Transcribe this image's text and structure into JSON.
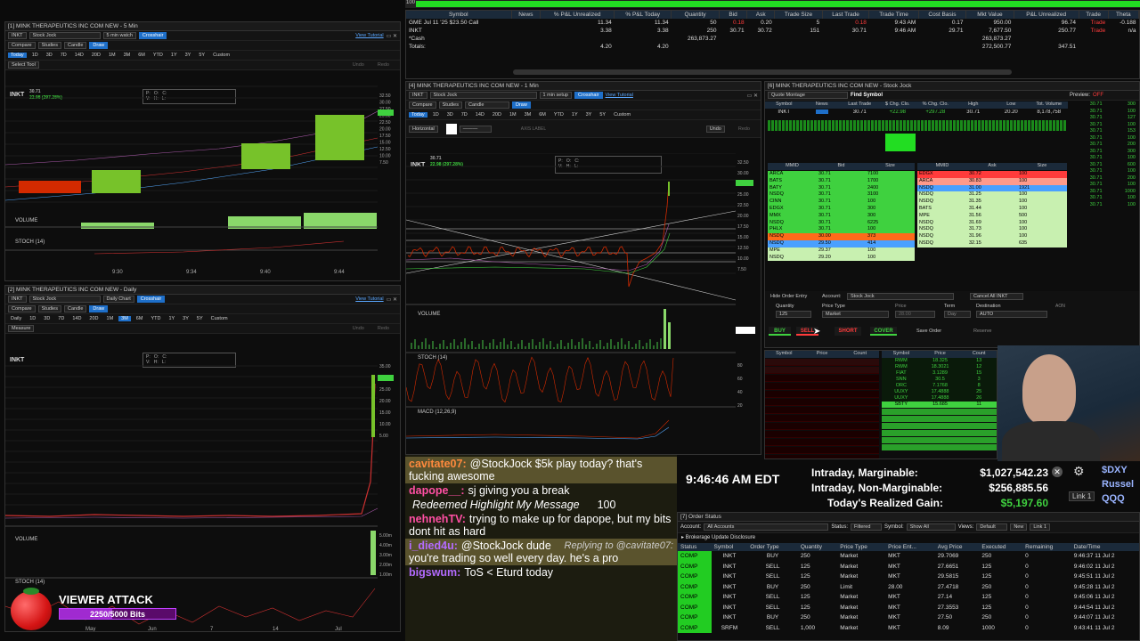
{
  "topbar": {
    "value": "100"
  },
  "watchlist": {
    "columns": [
      "Symbol",
      "News",
      "% P&L Unrealized",
      "% P&L Today",
      "Quantity",
      "Bid",
      "Ask",
      "Trade Size",
      "Last Trade",
      "Trade Time",
      "Cost Basis",
      "Mkt Value",
      "P&L Unrealized",
      "Trade",
      "Theta"
    ],
    "rows": [
      [
        "GME Jul 11 '25 $23.50 Call",
        "",
        "11.34",
        "11.34",
        "50",
        "0.18",
        "0.20",
        "5",
        "0.18",
        "9:43 AM",
        "0.17",
        "950.00",
        "96.74",
        "Trade",
        "-0.188"
      ],
      [
        "INKT",
        "",
        "3.38",
        "3.38",
        "250",
        "30.71",
        "30.72",
        "151",
        "30.71",
        "9:46 AM",
        "29.71",
        "7,677.50",
        "250.77",
        "Trade",
        "n/a"
      ],
      [
        "*Cash",
        "",
        "",
        "",
        "263,873.27",
        "",
        "",
        "",
        "",
        "",
        "",
        "263,873.27",
        "",
        "",
        ""
      ],
      [
        "Totals:",
        "",
        "4.20",
        "4.20",
        "",
        "",
        "",
        "",
        "",
        "",
        "",
        "272,500.77",
        "347.51",
        "",
        ""
      ]
    ]
  },
  "chart5min": {
    "title": "[1] MINK THERAPEUTICS INC COM NEW - 5 Min",
    "symbol": "INKT",
    "layout": "Stock Jock",
    "interval": "5 min watch",
    "crosshair": "Crosshair",
    "tutorial": "View Tutorial",
    "compare": "Compare",
    "studies": "Studies",
    "candle": "Candle",
    "draw": "Draw",
    "timeframes": [
      "Today",
      "1D",
      "3D",
      "7D",
      "14D",
      "20D",
      "1M",
      "3M",
      "6M",
      "YTD",
      "1Y",
      "3Y",
      "5Y",
      "Custom"
    ],
    "select_tool": "Select Tool",
    "undo": "Undo",
    "redo": "Redo",
    "price": "30.71",
    "change": "22.98 (297.28%)",
    "volume": "VOLUME",
    "stoch": "STOCH (14)",
    "xticks": [
      "9:30",
      "9:34",
      "9:40",
      "9:44"
    ],
    "yticks": [
      "32.50",
      "30.00",
      "27.50",
      "25.00",
      "22.50",
      "20.00",
      "17.50",
      "15.00",
      "12.50",
      "10.00",
      "7.50"
    ]
  },
  "chartDaily": {
    "title": "[2] MINK THERAPEUTICS INC COM NEW - Daily",
    "symbol": "INKT",
    "layout": "Stock Jock",
    "interval": "Daily Chart",
    "crosshair": "Crosshair",
    "tutorial": "View Tutorial",
    "timeframes": [
      "Daily",
      "1D",
      "3D",
      "7D",
      "14D",
      "20D",
      "1M",
      "3M",
      "6M",
      "YTD",
      "1Y",
      "3Y",
      "5Y",
      "Custom"
    ],
    "measure": "Measure",
    "volume": "VOLUME",
    "stoch": "STOCH (14)",
    "xticks": [
      "May",
      "Jun",
      "7",
      "14",
      "Jul"
    ],
    "yticks": [
      "35.00",
      "30.00",
      "25.00",
      "20.00",
      "15.00",
      "10.00",
      "5.00"
    ],
    "vol_ticks": [
      "5.00m",
      "4.00m",
      "3.00m",
      "2.00m",
      "1.00m"
    ]
  },
  "chart1min": {
    "title": "[4] MINK THERAPEUTICS INC COM NEW - 1 Min",
    "symbol": "INKT",
    "layout": "Stock Jock",
    "interval": "1 min setup",
    "crosshair": "Crosshair",
    "tutorial": "View Tutorial",
    "timeframes": [
      "Today",
      "1D",
      "3D",
      "7D",
      "14D",
      "20D",
      "1M",
      "3M",
      "6M",
      "YTD",
      "1Y",
      "3Y",
      "5Y",
      "Custom"
    ],
    "horizontal": "Horizontal",
    "undo": "Undo",
    "redo": "Redo",
    "axis_label": "AXIS LABEL",
    "price": "30.71",
    "change": "22.98 (297.28%)",
    "volume": "VOLUME",
    "stoch": "STOCH (14)",
    "macd": "MACD (12,26,9)",
    "yticks": [
      "32.50",
      "30.00",
      "27.50",
      "25.00",
      "22.50",
      "20.00",
      "17.50",
      "15.00",
      "12.50",
      "10.00",
      "7.50"
    ],
    "stoch_ticks": [
      "80",
      "60",
      "40",
      "20"
    ]
  },
  "level2": {
    "title": "[6] MINK THERAPEUTICS INC COM NEW - Stock Jock",
    "quote_montage": "Quote Montage",
    "find_symbol": "Find Symbol",
    "preview": "Preview:",
    "preview_val": "OFF",
    "q_headers": [
      "Symbol",
      "News",
      "Last Trade",
      "$ Chg. Clo.",
      "% Chg. Clo.",
      "High",
      "Low",
      "Tot. Volume"
    ],
    "q_values": [
      "INKT",
      "",
      "30.71",
      "+22.98",
      "+297.28",
      "30.71",
      "20.20",
      "8,178,758"
    ],
    "bid_header": [
      "MMID",
      "Bid",
      "Size"
    ],
    "ask_header": [
      "MMID",
      "Ask",
      "Size"
    ],
    "bids": [
      [
        "ARCA",
        "30.71",
        "7100"
      ],
      [
        "BATS",
        "30.71",
        "1700"
      ],
      [
        "BATY",
        "30.71",
        "2400"
      ],
      [
        "NSDQ",
        "30.71",
        "3100"
      ],
      [
        "CINN",
        "30.71",
        "100"
      ],
      [
        "EDGX",
        "30.71",
        "300"
      ],
      [
        "MMX",
        "30.71",
        "300"
      ],
      [
        "NSDQ",
        "30.71",
        "6225"
      ],
      [
        "PHLX",
        "30.71",
        "100"
      ],
      [
        "NSDQ",
        "30.00",
        "373"
      ],
      [
        "NSDQ",
        "29.50",
        "414"
      ],
      [
        "MPE",
        "29.37",
        "100"
      ],
      [
        "NSDQ",
        "29.20",
        "100"
      ]
    ],
    "asks": [
      [
        "EDGX",
        "30.72",
        "100"
      ],
      [
        "ARCA",
        "30.83",
        "100"
      ],
      [
        "NSDQ",
        "31.00",
        "1921"
      ],
      [
        "NSDQ",
        "31.25",
        "100"
      ],
      [
        "NSDQ",
        "31.35",
        "100"
      ],
      [
        "BATS",
        "31.44",
        "100"
      ],
      [
        "MPE",
        "31.56",
        "500"
      ],
      [
        "NSDQ",
        "31.69",
        "100"
      ],
      [
        "NSDQ",
        "31.73",
        "100"
      ],
      [
        "NSDQ",
        "31.96",
        "100"
      ],
      [
        "NSDQ",
        "32.15",
        "635"
      ]
    ],
    "ts": [
      [
        "30.71",
        "300"
      ],
      [
        "30.71",
        "100"
      ],
      [
        "30.71",
        "127"
      ],
      [
        "30.71",
        "100"
      ],
      [
        "30.71",
        "153"
      ],
      [
        "30.71",
        "100"
      ],
      [
        "30.71",
        "200"
      ],
      [
        "30.71",
        "300"
      ],
      [
        "30.71",
        "100"
      ],
      [
        "30.71",
        "600"
      ],
      [
        "30.71",
        "100"
      ],
      [
        "30.71",
        "200"
      ],
      [
        "30.71",
        "100"
      ],
      [
        "30.71",
        "1000"
      ],
      [
        "30.71",
        "100"
      ],
      [
        "30.71",
        "100"
      ]
    ],
    "hide_order": "Hide Order Entry",
    "account_label": "Account:",
    "account": "Stock Jock",
    "cancel_all": "Cancel All INKT",
    "quantity_label": "Quantity",
    "quantity": "125",
    "price_type_label": "Price Type",
    "price_type": "Market",
    "price_label": "Price",
    "price_val": "28.00",
    "term_label": "Term",
    "term": "Day",
    "dest_label": "Destination",
    "dest": "AUTO",
    "aon": "AON",
    "buy": "BUY",
    "sell": "SELL",
    "short": "SHORT",
    "cover": "COVER",
    "save_order": "Save Order",
    "reserve": "Reserve"
  },
  "scanner": {
    "headers": [
      "Symbol",
      "Price",
      "Count"
    ],
    "right": [
      [
        "RWM",
        "18.325",
        "13"
      ],
      [
        "RWM",
        "18.3021",
        "12"
      ],
      [
        "FIAT",
        "3.1289",
        "15"
      ],
      [
        "SNN",
        "30.5",
        "3"
      ],
      [
        "ORC",
        "7.1768",
        "8"
      ],
      [
        "UUXY",
        "17.4888",
        "25"
      ],
      [
        "UUXY",
        "17.4888",
        "26"
      ],
      [
        "SBTY",
        "15.685",
        "11"
      ]
    ]
  },
  "overlay": {
    "time": "9:46:46 AM EDT",
    "intraday_marginable_label": "Intraday, Marginable:",
    "intraday_marginable": "$1,027,542.23",
    "intraday_non_label": "Intraday, Non-Marginable:",
    "intraday_non": "$256,885.56",
    "realized_label": "Today's Realized Gain:",
    "realized": "$5,197.60",
    "tickers": [
      "$DXY",
      "Russel",
      "QQQ"
    ],
    "link": "Link 1"
  },
  "viewer_attack": {
    "title": "VIEWER ATTACK",
    "progress_text": "2250/5000 Bits",
    "progress": 0.45
  },
  "chat": [
    {
      "user": "cavitate07:",
      "text": "@StockJock $5k play today? that's fucking awesome",
      "color": "#ff8a3d"
    },
    {
      "user": "dapope__:",
      "text": "sj giving you a break",
      "color": "#ff4fa3"
    },
    {
      "user": "",
      "text": "Redeemed Highlight My Message",
      "color": "#ffffff",
      "extra": "100"
    },
    {
      "user": "nehnehTV:",
      "text": "trying to make up for dapope, but my bits dont hit as hard",
      "color": "#ff4fa3"
    },
    {
      "user": "i_died4u:",
      "text": "@StockJock dude you're trading so well every day. he's a pro",
      "color": "#b46bff",
      "reply": "Replying to @cavitate07:"
    },
    {
      "user": "bigswum:",
      "text": "ToS < Eturd today",
      "color": "#b46bff"
    }
  ],
  "orders": {
    "title": "[7] Order Status",
    "account_label": "Account:",
    "account": "All Accounts",
    "status_label": "Status:",
    "status": "Filtered",
    "symbol_label": "Symbol:",
    "symbol": "Show All",
    "views_label": "Views:",
    "views": "Default",
    "new": "New",
    "link": "Link 1",
    "disclosure": "Brokerage Update Disclosure",
    "columns": [
      "Status",
      "Symbol",
      "Order Type",
      "Quantity",
      "Price Type",
      "Price Ent...",
      "Avg Price",
      "Executed",
      "Remaining",
      "Date/Time"
    ],
    "rows": [
      [
        "COMP",
        "INKT",
        "BUY",
        "250",
        "Market",
        "MKT",
        "29.7069",
        "250",
        "0",
        "9:46:37 11 Jul 2"
      ],
      [
        "COMP",
        "INKT",
        "SELL",
        "125",
        "Market",
        "MKT",
        "27.6651",
        "125",
        "0",
        "9:46:02 11 Jul 2"
      ],
      [
        "COMP",
        "INKT",
        "SELL",
        "125",
        "Market",
        "MKT",
        "29.5815",
        "125",
        "0",
        "9:45:51 11 Jul 2"
      ],
      [
        "COMP",
        "INKT",
        "BUY",
        "250",
        "Limit",
        "28.00",
        "27.4718",
        "250",
        "0",
        "9:45:28 11 Jul 2"
      ],
      [
        "COMP",
        "INKT",
        "SELL",
        "125",
        "Market",
        "MKT",
        "27.14",
        "125",
        "0",
        "9:45:06 11 Jul 2"
      ],
      [
        "COMP",
        "INKT",
        "SELL",
        "125",
        "Market",
        "MKT",
        "27.3553",
        "125",
        "0",
        "9:44:54 11 Jul 2"
      ],
      [
        "COMP",
        "INKT",
        "BUY",
        "250",
        "Market",
        "MKT",
        "27.50",
        "250",
        "0",
        "9:44:07 11 Jul 2"
      ],
      [
        "COMP",
        "SRFM",
        "SELL",
        "1,000",
        "Market",
        "MKT",
        "8.09",
        "1000",
        "0",
        "9:43:41 11 Jul 2"
      ]
    ]
  },
  "colors": {
    "green": "#3fd13f",
    "red": "#ff3b3b",
    "blue": "#1e6fc9",
    "panel": "#0d0d0d"
  }
}
